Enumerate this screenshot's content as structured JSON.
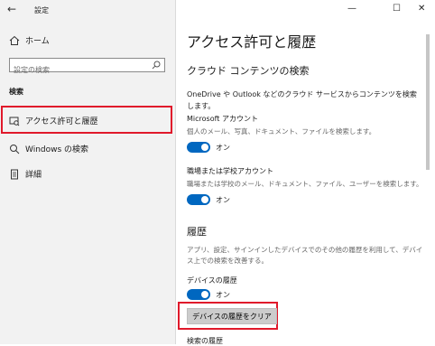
{
  "window": {
    "back_glyph": "←",
    "title": "設定"
  },
  "controls": {
    "minimize": "—",
    "maximize": "☐",
    "close": "✕"
  },
  "sidebar": {
    "home_label": "ホーム",
    "search_placeholder": "設定の検索",
    "section_heading": "検索",
    "items": [
      {
        "label": "アクセス許可と履歴",
        "icon": "lock-search-icon",
        "selected": true
      },
      {
        "label": "Windows の検索",
        "icon": "search-icon",
        "selected": false
      },
      {
        "label": "詳細",
        "icon": "document-icon",
        "selected": false
      }
    ]
  },
  "main": {
    "title": "アクセス許可と履歴",
    "cloud_heading": "クラウド コンテンツの検索",
    "cloud_desc": "OneDrive や Outlook などのクラウド サービスからコンテンツを検索します。",
    "ms_account": {
      "label": "Microsoft アカウント",
      "desc": "個人のメール、写真、ドキュメント、ファイルを検索します。",
      "toggle_state": "オン"
    },
    "work_account": {
      "label": "職場または学校アカウント",
      "desc": "職場または学校のメール、ドキュメント、ファイル、ユーザーを検索します。",
      "toggle_state": "オン"
    },
    "history_heading": "履歴",
    "history_desc": "アプリ、設定、サインインしたデバイスでのその他の履歴を利用して、デバイス上での検索を改善する。",
    "device_history": {
      "label": "デバイスの履歴",
      "toggle_state": "オン"
    },
    "clear_button": "デバイスの履歴をクリア",
    "next_heading": "検索の履歴"
  },
  "colors": {
    "accent": "#0067c0",
    "highlight": "#e0192b"
  }
}
